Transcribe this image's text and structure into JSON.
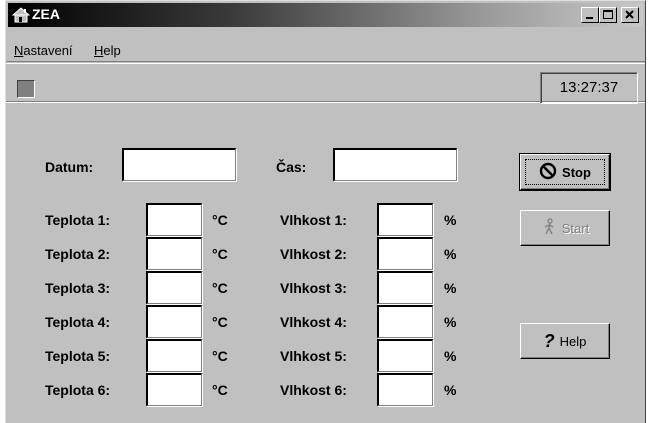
{
  "window": {
    "title": "ZEA"
  },
  "menu": {
    "nastaveni": "Nastavení",
    "help": "Help"
  },
  "toolbar": {
    "clock": "13:27:37"
  },
  "form": {
    "datum_label": "Datum:",
    "datum_value": "",
    "cas_label": "Čas:",
    "cas_value": "",
    "teplota": [
      {
        "label": "Teplota 1:",
        "value": "",
        "unit": "°C"
      },
      {
        "label": "Teplota 2:",
        "value": "",
        "unit": "°C"
      },
      {
        "label": "Teplota 3:",
        "value": "",
        "unit": "°C"
      },
      {
        "label": "Teplota 4:",
        "value": "",
        "unit": "°C"
      },
      {
        "label": "Teplota 5:",
        "value": "",
        "unit": "°C"
      },
      {
        "label": "Teplota 6:",
        "value": "",
        "unit": "°C"
      }
    ],
    "vlhkost": [
      {
        "label": "Vlhkost 1:",
        "value": "",
        "unit": "%"
      },
      {
        "label": "Vlhkost 2:",
        "value": "",
        "unit": "%"
      },
      {
        "label": "Vlhkost 3:",
        "value": "",
        "unit": "%"
      },
      {
        "label": "Vlhkost 4:",
        "value": "",
        "unit": "%"
      },
      {
        "label": "Vlhkost 5:",
        "value": "",
        "unit": "%"
      },
      {
        "label": "Vlhkost 6:",
        "value": "",
        "unit": "%"
      }
    ]
  },
  "buttons": {
    "stop": {
      "label": "Stop",
      "icon": "stop-icon"
    },
    "start": {
      "label": "Start",
      "icon": "walking-man-icon",
      "disabled": true
    },
    "help": {
      "label": "Help",
      "icon": "question-mark-icon"
    }
  },
  "colors": {
    "window_bg": "#c0c0c0",
    "title_gradient_start": "#000000",
    "indicator": "#808080"
  }
}
